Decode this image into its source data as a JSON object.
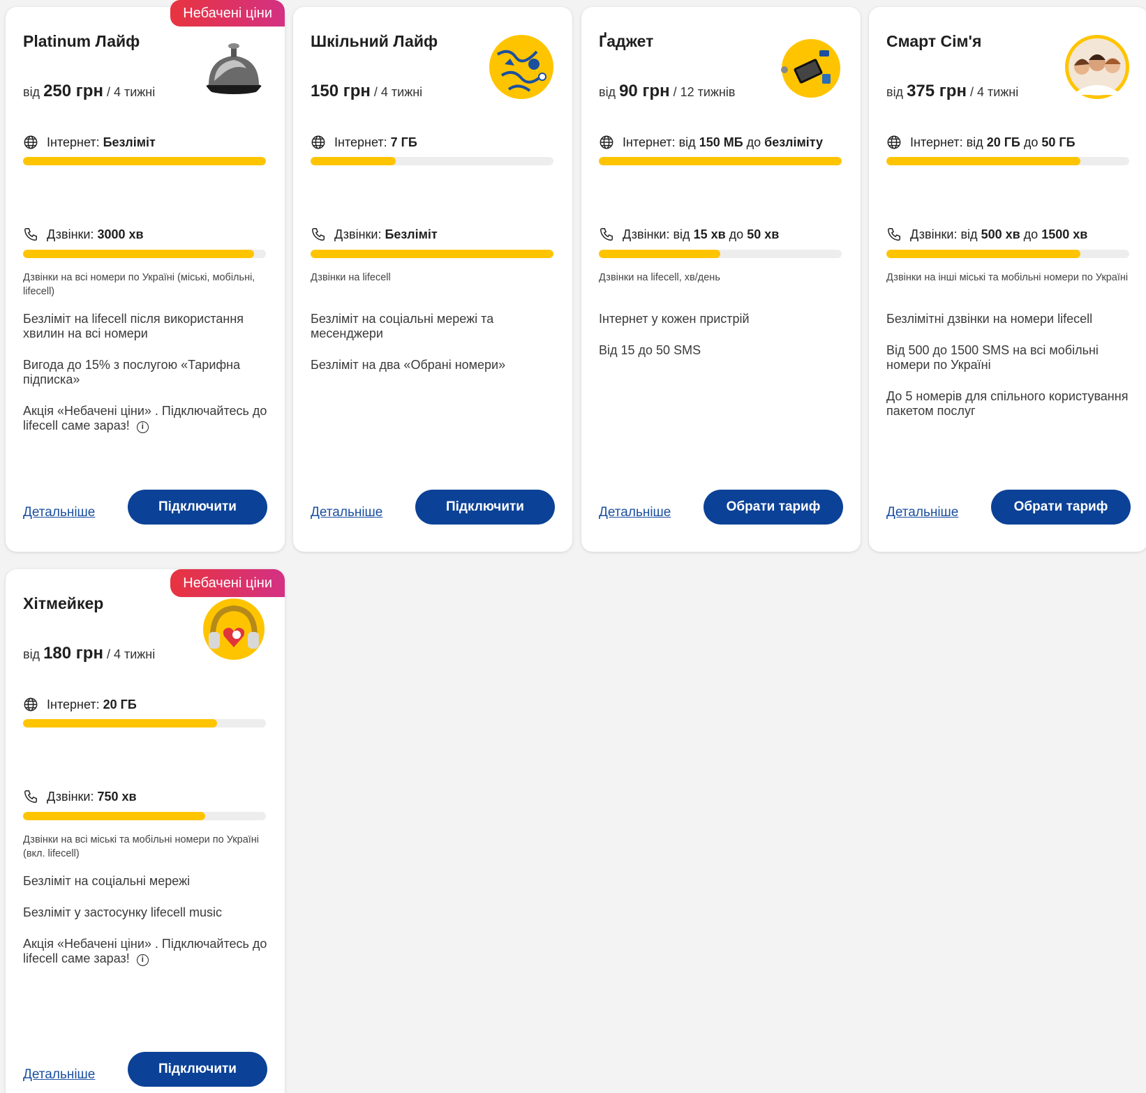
{
  "cards": [
    {
      "badge": "Небачені ціни",
      "title": "Platinum Лайф",
      "price_prefix": "від ",
      "price": "250 грн",
      "period": " / 4 тижні",
      "inet_label": "Інтернет: ",
      "inet_parts": [
        "",
        "Безліміт",
        "",
        ""
      ],
      "inet_level": 1.0,
      "calls_label": "Дзвінки: ",
      "calls_parts": [
        "",
        "3000 хв",
        "",
        ""
      ],
      "calls_level": 0.95,
      "note": "Дзвінки на всі номери по Україні (міські, мобільні, lifecell)",
      "lines": [
        "Безліміт на lifecell після використання хвилин на всі номери",
        "Вигода до 15% з послугою «Тарифна підписка»",
        "Акція «Небачені ціни» . Підключайтесь до lifecell саме зараз!"
      ],
      "more": "Детальніше",
      "button": "Підключити",
      "icon": "service-bell-icon"
    },
    {
      "title": "Шкільний Лайф",
      "price_prefix": "",
      "price": "150 грн",
      "period": " / 4 тижні",
      "inet_label": "Інтернет: ",
      "inet_parts": [
        "",
        "7 ГБ",
        "",
        ""
      ],
      "inet_level": 0.35,
      "calls_label": "Дзвінки: ",
      "calls_parts": [
        "",
        "Безліміт",
        "",
        ""
      ],
      "calls_level": 1.0,
      "note": "Дзвінки на lifecell",
      "lines": [
        "Безліміт на соціальні мережі та месенджери",
        "Безліміт на два «Обрані номери»"
      ],
      "more": "Детальніше",
      "button": "Підключити",
      "icon": "school-doodle-icon"
    },
    {
      "title": "Ґаджет",
      "price_prefix": "від ",
      "price": "90 грн",
      "period": " / 12 тижнів",
      "inet_label": "Інтернет: ",
      "inet_parts": [
        "від ",
        "150 МБ",
        " до ",
        "безліміту"
      ],
      "inet_level": 1.0,
      "calls_label": "Дзвінки: ",
      "calls_parts": [
        "від ",
        "15 хв",
        " до ",
        "50 хв"
      ],
      "calls_level": 0.5,
      "note": "Дзвінки на lifecell, хв/день",
      "lines": [
        "Інтернет у кожен пристрій",
        "Від 15 до 50 SMS"
      ],
      "more": "Детальніше",
      "button": "Обрати тариф",
      "icon": "gadgets-icon"
    },
    {
      "title": "Смарт Сім'я",
      "price_prefix": "від ",
      "price": "375 грн",
      "period": " / 4 тижні",
      "inet_label": "Інтернет: ",
      "inet_parts": [
        "від ",
        "20 ГБ",
        " до ",
        "50 ГБ"
      ],
      "inet_level": 0.8,
      "calls_label": "Дзвінки: ",
      "calls_parts": [
        "від ",
        "500 хв",
        " до ",
        "1500 хв"
      ],
      "calls_level": 0.8,
      "note": "Дзвінки на інші міські та мобільні номери по Україні",
      "lines": [
        "Безлімітні дзвінки на номери lifecell",
        "Від 500 до 1500 SMS на всі мобільні номери по Україні",
        "До 5 номерів для спільного користування пакетом послуг"
      ],
      "more": "Детальніше",
      "button": "Обрати тариф",
      "icon": "family-photo-icon"
    },
    {
      "badge": "Небачені ціни",
      "title": "Хітмейкер",
      "price_prefix": "від ",
      "price": "180 грн",
      "period": " / 4 тижні",
      "inet_label": "Інтернет: ",
      "inet_parts": [
        "",
        "20 ГБ",
        "",
        ""
      ],
      "inet_level": 0.8,
      "calls_label": "Дзвінки: ",
      "calls_parts": [
        "",
        "750 хв",
        "",
        ""
      ],
      "calls_level": 0.75,
      "note": "Дзвінки на всі міські та мобільні номери по Україні (вкл. lifecell)",
      "lines": [
        "Безліміт на соціальні мережі",
        "Безліміт у застосунку lifecell music",
        "Акція «Небачені ціни» . Підключайтесь до lifecell саме зараз!"
      ],
      "more": "Детальніше",
      "button": "Підключити",
      "icon": "headphones-icon"
    }
  ],
  "colors": {
    "accent": "#ffc400",
    "button": "#0b4297",
    "link": "#1b4fa0",
    "badge_from": "#e8343f",
    "badge_to": "#d33184"
  }
}
